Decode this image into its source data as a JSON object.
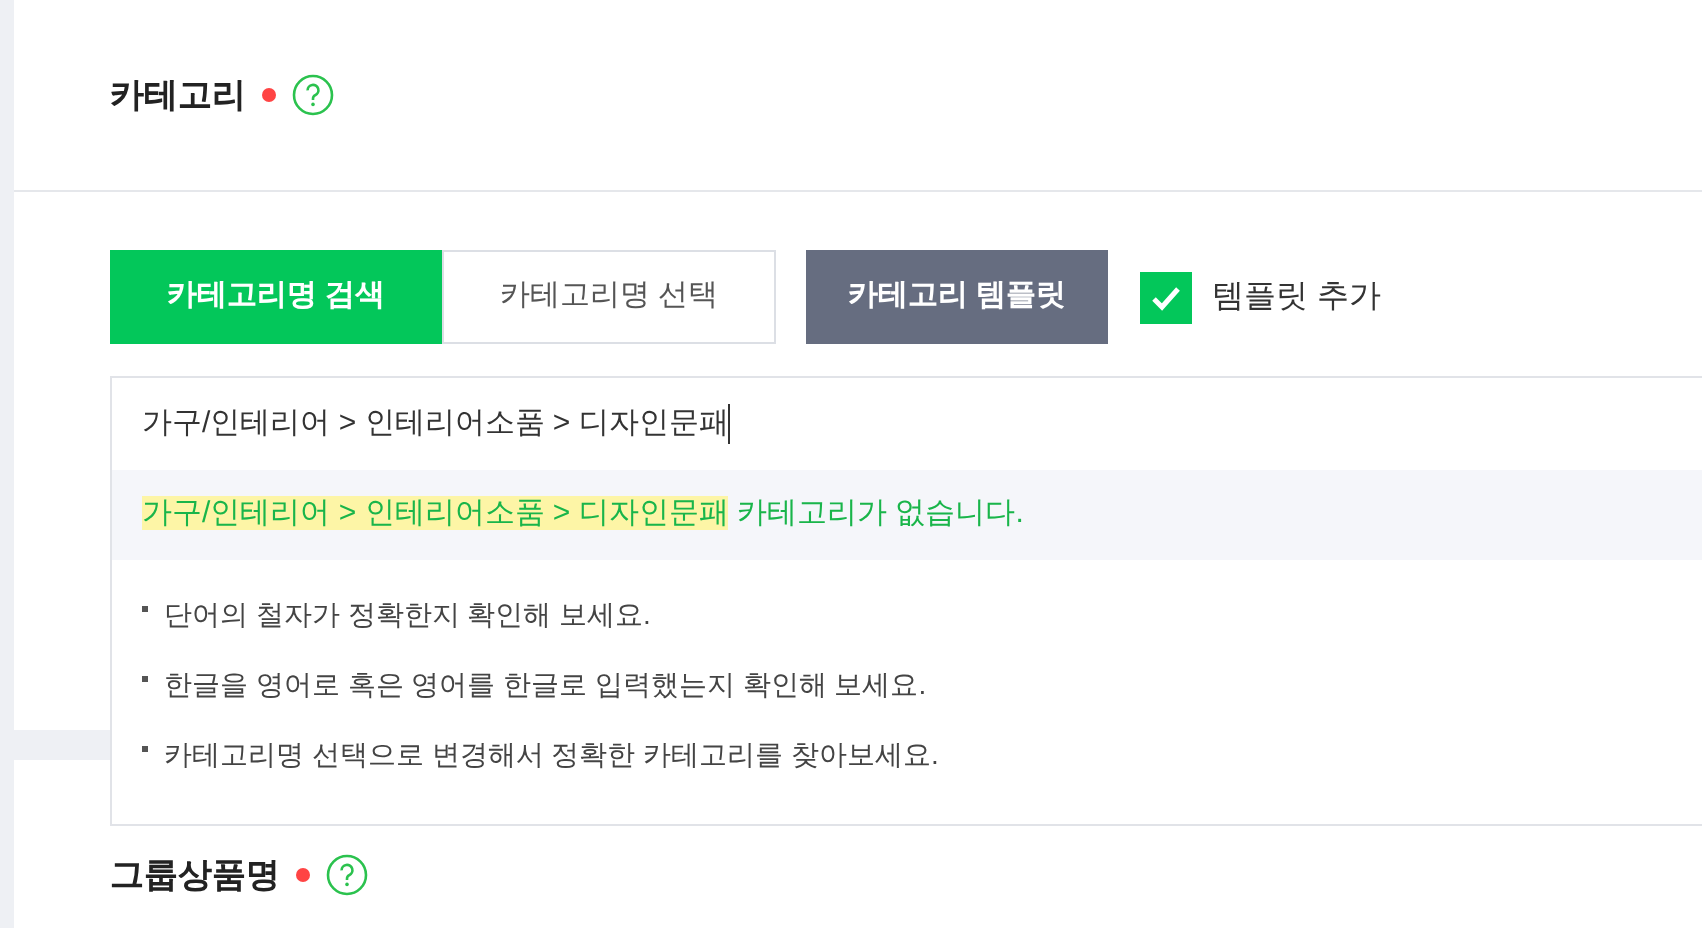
{
  "category_section": {
    "title": "카테고리",
    "required": true,
    "tabs": [
      {
        "label": "카테고리명 검색",
        "selected": true
      },
      {
        "label": "카테고리명 선택",
        "selected": false
      }
    ],
    "template_button": "카테고리 템플릿",
    "template_checkbox": {
      "label": "템플릿 추가",
      "checked": true
    },
    "search": {
      "value": "가구/인테리어 > 인테리어소품 > 디자인문패"
    },
    "result": {
      "highlight": "가구/인테리어 > 인테리어소품 > 디자인문패",
      "message": "카테고리가 없습니다."
    },
    "tips": [
      "단어의 철자가 정확한지 확인해 보세요.",
      "한글을 영어로 혹은 영어를 한글로 입력했는지 확인해 보세요.",
      "카테고리명 선택으로 변경해서 정확한 카테고리를 찾아보세요."
    ]
  },
  "group_section": {
    "title": "그룹상품명",
    "required": true
  }
}
